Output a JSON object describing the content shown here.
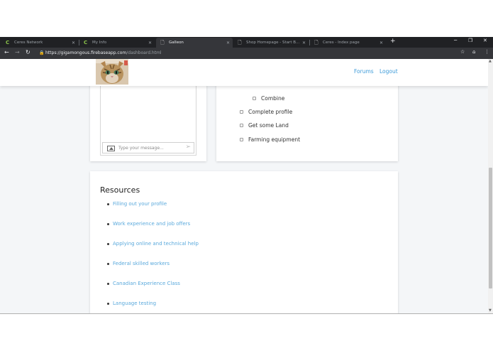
{
  "browser": {
    "tabs": [
      {
        "label": "Ceres Network",
        "icon": "ceres-logo-icon",
        "active": false
      },
      {
        "label": "My Info",
        "icon": "ceres-logo-icon",
        "active": false
      },
      {
        "label": "Galleon",
        "icon": "page-icon",
        "active": true
      },
      {
        "label": "Shop Homepage - Start Bootstr...",
        "icon": "page-icon",
        "active": false
      },
      {
        "label": "Ceres - Index page",
        "icon": "page-icon",
        "active": false
      }
    ],
    "url_host": "https://gigamongous.firebaseapp.com",
    "url_path": "/dashboard.html"
  },
  "navbar": {
    "forums_label": "Forums",
    "logout_label": "Logout"
  },
  "chat": {
    "placeholder": "Type your message..."
  },
  "tasks": [
    {
      "label": "Combine",
      "indent": true
    },
    {
      "label": "Complete profile",
      "indent": false
    },
    {
      "label": "Get some Land",
      "indent": false
    },
    {
      "label": "Farming equipment",
      "indent": false
    }
  ],
  "resources": {
    "title": "Resources",
    "items": [
      "Filling out your profile",
      "Work experience and job offers",
      "Applying online and technical help",
      "Federal skilled workers",
      "Canadian Experience Class",
      "Language testing"
    ]
  },
  "colors": {
    "link": "#3d9bd9",
    "chrome_dark": "#202124",
    "page_bg": "#f4f6f8"
  }
}
